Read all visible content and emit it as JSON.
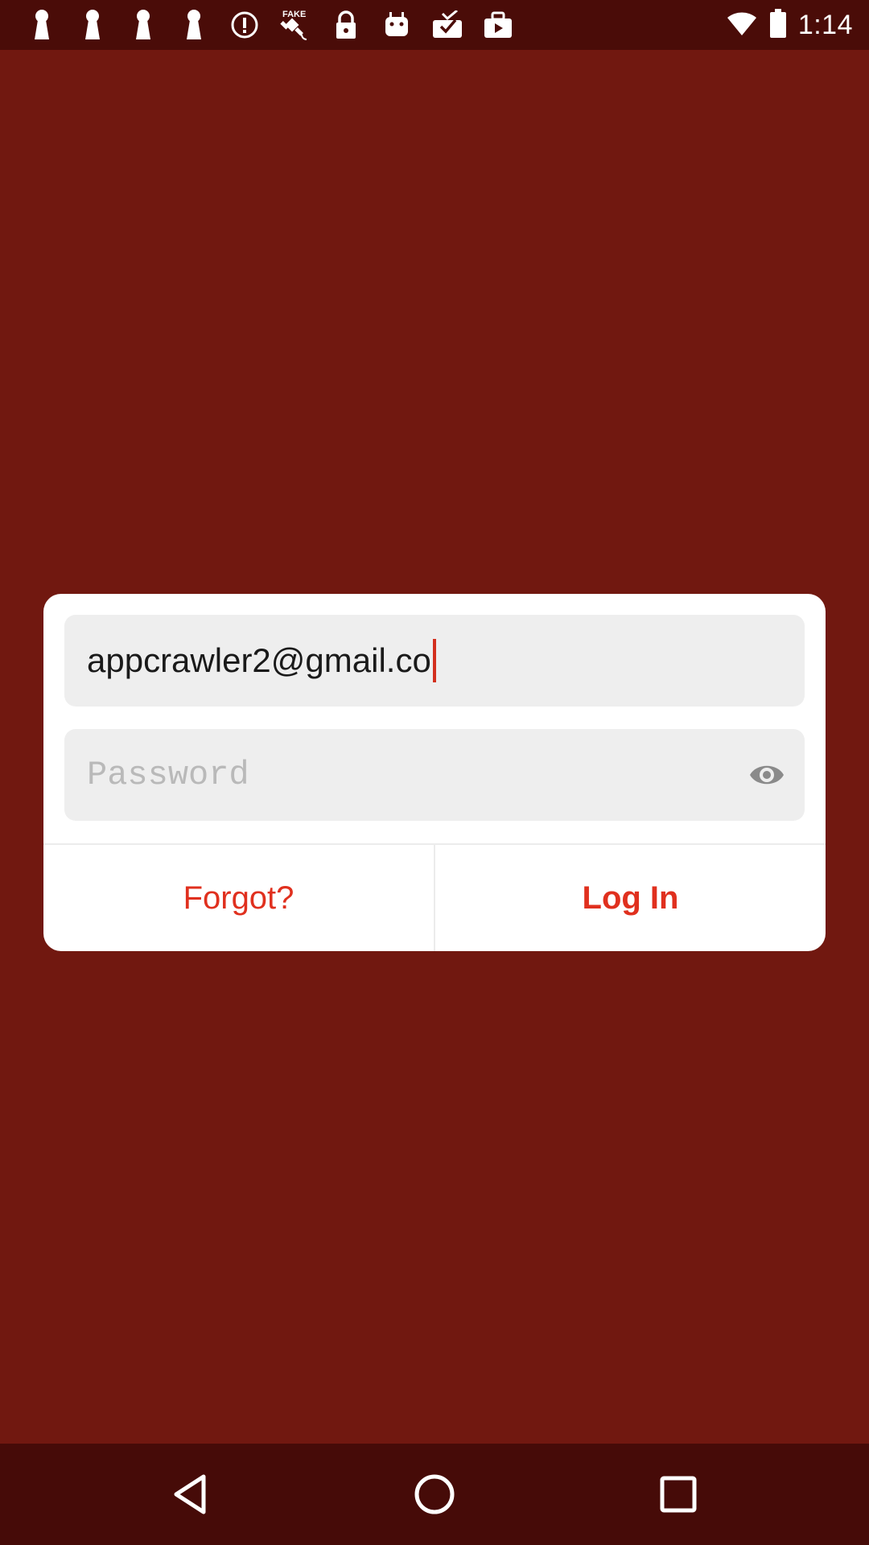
{
  "status_bar": {
    "time": "1:14",
    "left_icons": [
      "notification-icon",
      "notification-icon",
      "notification-icon",
      "notification-icon",
      "alert-icon",
      "fake-gps-icon",
      "lock-icon",
      "android-icon",
      "task-icon",
      "briefcase-icon"
    ],
    "right_icons": [
      "wifi-icon",
      "battery-icon"
    ]
  },
  "login": {
    "email_value": "appcrawler2@gmail.co",
    "password_placeholder": "Password",
    "forgot_label": "Forgot?",
    "login_label": "Log In"
  },
  "nav_bar": {
    "icons": [
      "back-icon",
      "home-icon",
      "recent-apps-icon"
    ]
  },
  "colors": {
    "background": "#711810",
    "status_bar": "#4a0c08",
    "nav_bar": "#460b08",
    "accent": "#e0301e",
    "field": "#eeeeee"
  }
}
